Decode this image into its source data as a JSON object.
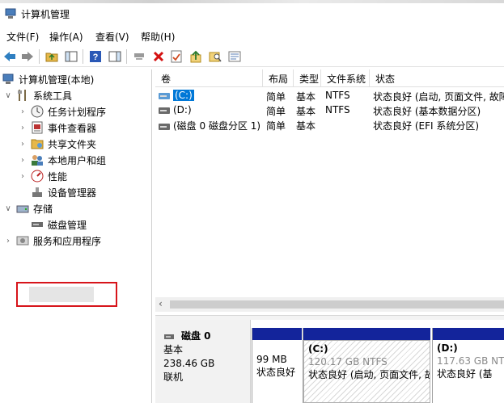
{
  "window": {
    "title": "计算机管理"
  },
  "menu": [
    "文件(F)",
    "操作(A)",
    "查看(V)",
    "帮助(H)"
  ],
  "tree": {
    "root": "计算机管理(本地)",
    "system_tools": "系统工具",
    "task_scheduler": "任务计划程序",
    "event_viewer": "事件查看器",
    "shared_folders": "共享文件夹",
    "local_users": "本地用户和组",
    "performance": "性能",
    "device_manager": "设备管理器",
    "storage": "存储",
    "disk_management": "磁盘管理",
    "services": "服务和应用程序"
  },
  "volume_list": {
    "columns": [
      "卷",
      "布局",
      "类型",
      "文件系统",
      "状态"
    ],
    "rows": [
      {
        "volume": "(C:)",
        "layout": "简单",
        "type": "基本",
        "fs": "NTFS",
        "status": "状态良好 (启动, 页面文件, 故障"
      },
      {
        "volume": "(D:)",
        "layout": "简单",
        "type": "基本",
        "fs": "NTFS",
        "status": "状态良好 (基本数据分区)"
      },
      {
        "volume": "(磁盘 0 磁盘分区 1)",
        "layout": "简单",
        "type": "基本",
        "fs": "",
        "status": "状态良好 (EFI 系统分区)"
      }
    ]
  },
  "disk0": {
    "name": "磁盘 0",
    "kind": "基本",
    "size": "238.46 GB",
    "state": "联机",
    "partitions": [
      {
        "label": "",
        "size": "99 MB",
        "status": "状态良好"
      },
      {
        "label": "(C:)",
        "size": "120.17 GB NTFS",
        "status": "状态良好 (启动, 页面文件, 故"
      },
      {
        "label": "(D:)",
        "size": "117.63 GB NT",
        "status": "状态良好 (基"
      }
    ]
  },
  "colors": {
    "partition_bar": "#13249b",
    "highlight_box": "#d7141a",
    "selection": "#0078d7"
  }
}
